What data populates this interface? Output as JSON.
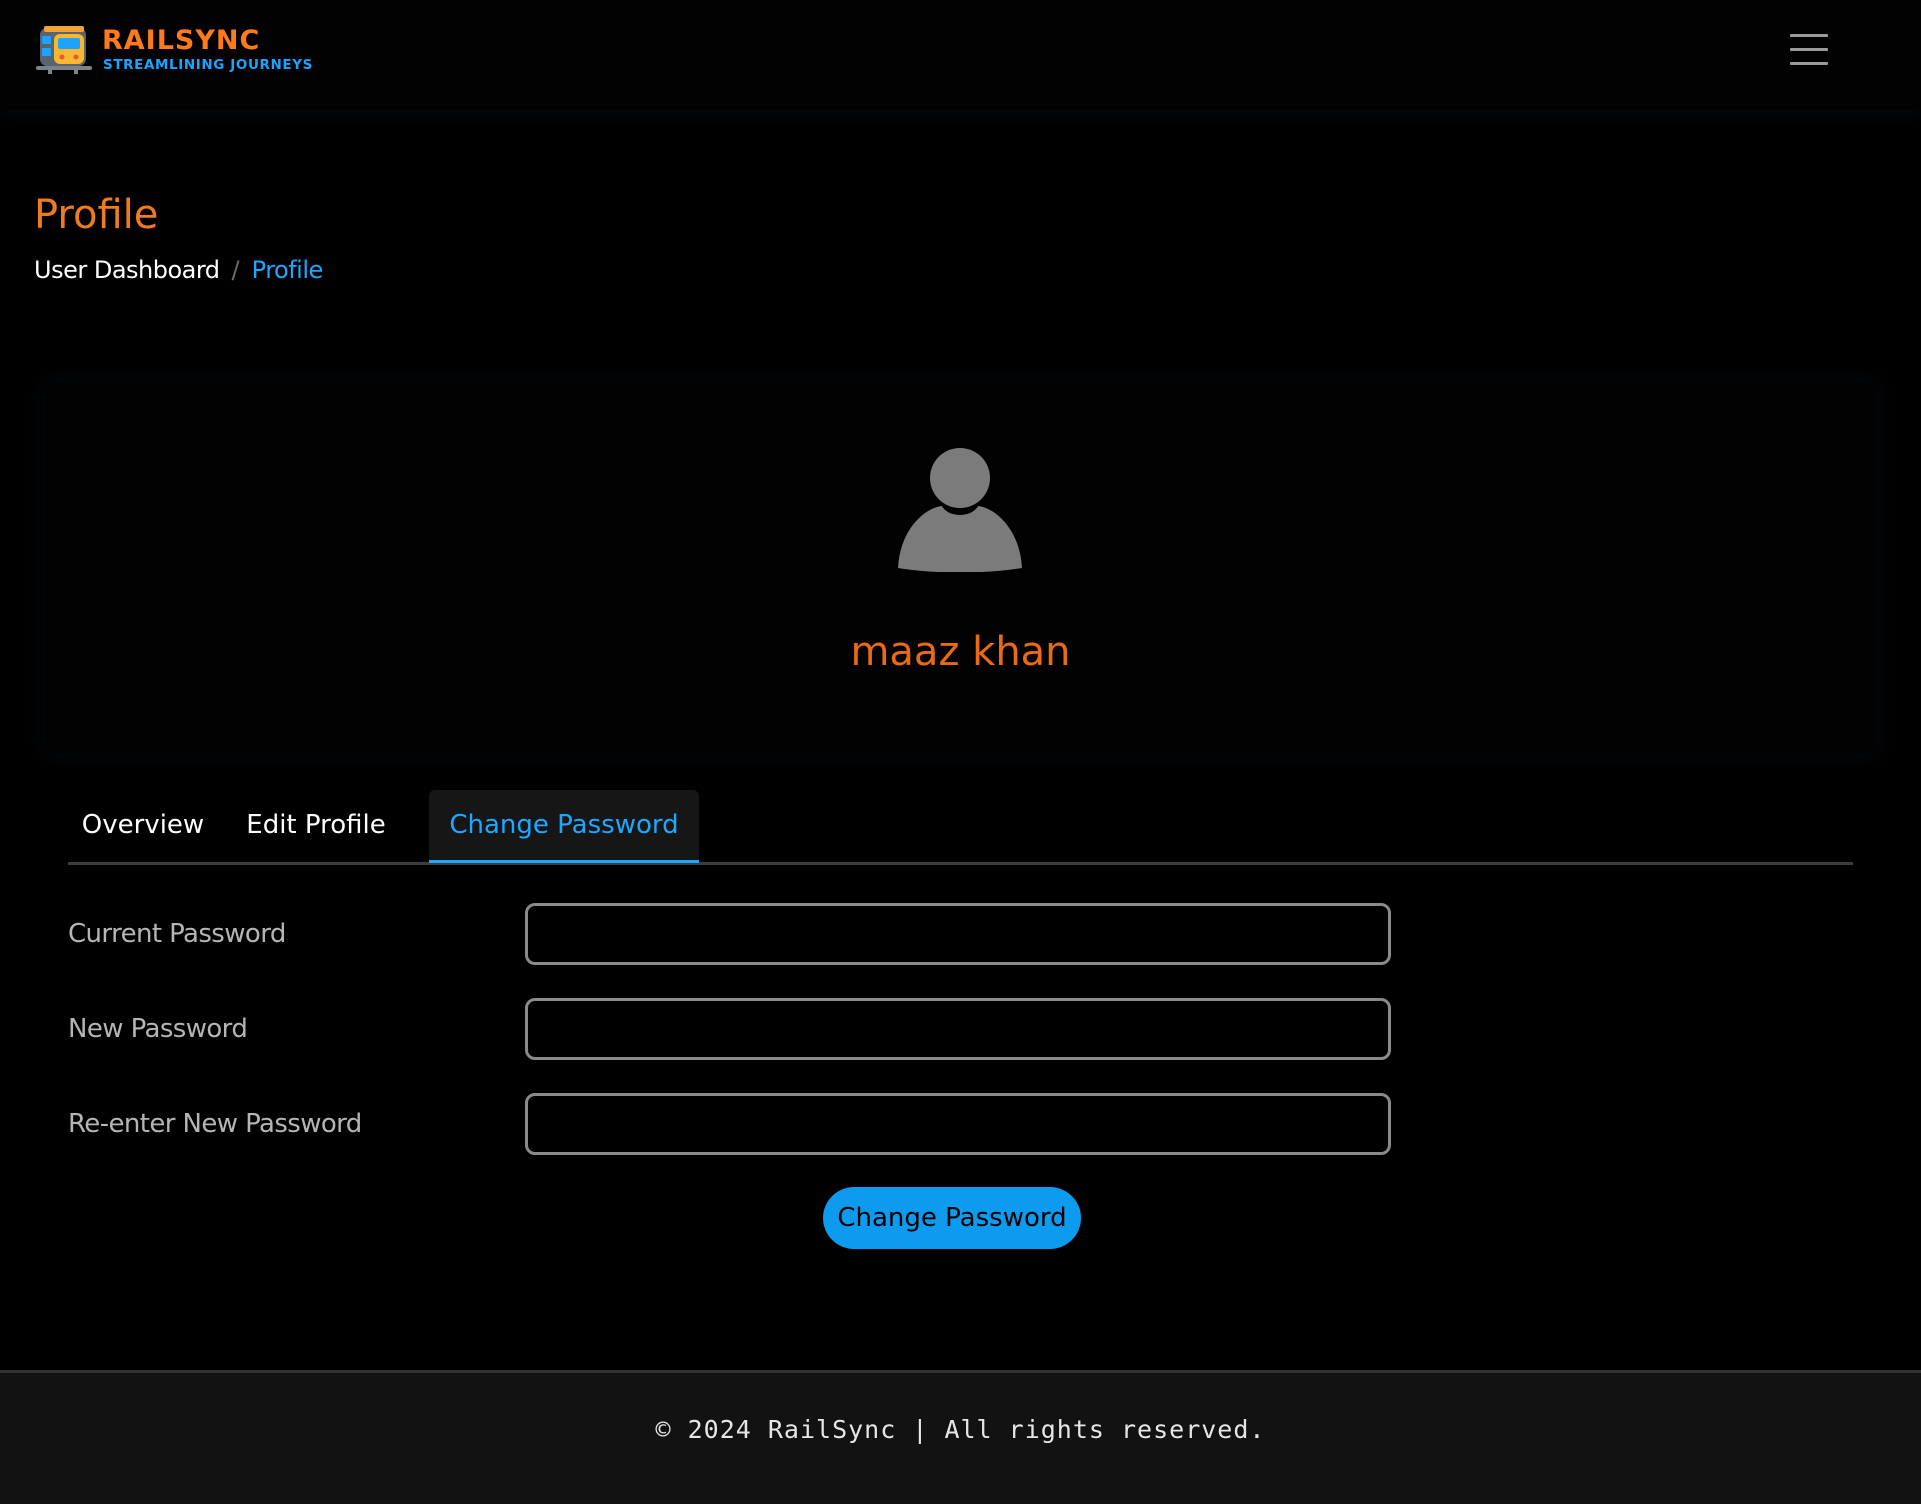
{
  "brand": {
    "name": "RAILSYNC",
    "tagline": "STREAMLINING JOURNEYS",
    "logo_icon": "train-icon",
    "colors": {
      "orange": "#ff7a1a",
      "blue": "#1aa3ff"
    }
  },
  "header": {
    "menu_icon": "hamburger-menu-icon"
  },
  "page": {
    "title": "Profile",
    "breadcrumb": {
      "home": "User Dashboard",
      "separator": "/",
      "current": "Profile"
    }
  },
  "profile": {
    "avatar_icon": "user-avatar-icon",
    "name": "maaz khan"
  },
  "tabs": [
    {
      "label": "Overview",
      "active": false
    },
    {
      "label": "Edit Profile",
      "active": false
    },
    {
      "label": "Change Password",
      "active": true
    }
  ],
  "form": {
    "fields": [
      {
        "label": "Current Password",
        "value": ""
      },
      {
        "label": "New Password",
        "value": ""
      },
      {
        "label": "Re-enter New Password",
        "value": ""
      }
    ],
    "submit_label": "Change Password"
  },
  "footer": {
    "text": "© 2024 RailSync | All rights reserved."
  },
  "theme": {
    "accent": "#1ea7ff",
    "title_orange": "#f07a1e",
    "background": "#000000"
  }
}
